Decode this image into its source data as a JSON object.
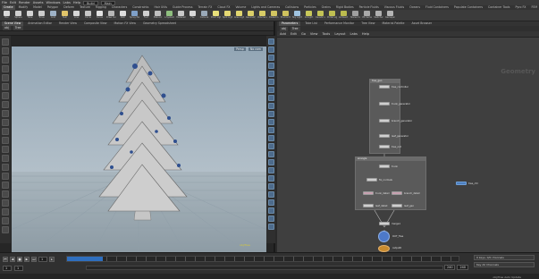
{
  "menubar": {
    "items": [
      "File",
      "Edit",
      "Render",
      "Assets",
      "Windows",
      "Labs",
      "Help"
    ],
    "build_select": "Build",
    "desktop_select": "Main"
  },
  "shelf_tabs": [
    "Create",
    "Modify",
    "Model",
    "Polygon",
    "Deform",
    "Texture",
    "Rigging",
    "Characters",
    "Constraints",
    "Hair Utils",
    "Guide Process",
    "Terrain FX",
    "Cloud FX",
    "Volume",
    "Lights and Cameras",
    "Collisions",
    "Particles",
    "Grains",
    "Rigid Bodies",
    "Particle Fluids",
    "Viscous Fluids",
    "Oceans",
    "Fluid Containers",
    "Populate Containers",
    "Container Tools",
    "Pyro FX",
    "FEM",
    "Wires",
    "Crowds",
    "Drive Simulation"
  ],
  "shelf_tools": [
    {
      "label": "Box",
      "color": "#d9d9d9"
    },
    {
      "label": "Sphere",
      "color": "#cfcfcf"
    },
    {
      "label": "Tube",
      "color": "#d4d4d4"
    },
    {
      "label": "Torus",
      "color": "#cccccc"
    },
    {
      "label": "Grid",
      "color": "#9fb3c8"
    },
    {
      "label": "Null",
      "color": "#e0c46a"
    },
    {
      "label": "Line",
      "color": "#d6d6d6"
    },
    {
      "label": "Circle",
      "color": "#c8c8c8"
    },
    {
      "label": "Curve",
      "color": "#e2e2e2"
    },
    {
      "label": "Draw Curve",
      "color": "#b8b8b8"
    },
    {
      "label": "Path",
      "color": "#dddddd"
    },
    {
      "label": "Spray Paint",
      "color": "#7fa0c8"
    },
    {
      "label": "Font",
      "color": "#d0d0d0"
    },
    {
      "label": "Platonic",
      "color": "#c0c0c0"
    },
    {
      "label": "L-System",
      "color": "#8fbf7f"
    },
    {
      "label": "Metaball",
      "color": "#c9c9c9"
    },
    {
      "label": "File",
      "color": "#d8d8d8"
    },
    {
      "label": "Camera",
      "color": "#9aa9b8"
    },
    {
      "label": "Point Light",
      "color": "#e8e07a"
    },
    {
      "label": "Spot Light",
      "color": "#e5d873"
    },
    {
      "label": "Area Light",
      "color": "#e1d66f"
    },
    {
      "label": "Geometry Light",
      "color": "#dcd069"
    },
    {
      "label": "Volume Light",
      "color": "#d8cc66"
    },
    {
      "label": "Distant Light",
      "color": "#d2c561"
    },
    {
      "label": "Environment Light",
      "color": "#cfc25e"
    },
    {
      "label": "Sky Light",
      "color": "#9fc3e0"
    },
    {
      "label": "GI Light",
      "color": "#c9c95a"
    },
    {
      "label": "Caustic Light",
      "color": "#c4c456"
    },
    {
      "label": "Portal Light",
      "color": "#bfbf52"
    },
    {
      "label": "Ambient Light",
      "color": "#bbbb4e"
    },
    {
      "label": "Stereo Camera",
      "color": "#a0a0a0"
    },
    {
      "label": "VR Camera",
      "color": "#a8a8a8"
    },
    {
      "label": "Switcher",
      "color": "#b0b0b0"
    },
    {
      "label": "Gamepad Camera",
      "color": "#b5b5b5"
    }
  ],
  "viewer": {
    "tabs": [
      "Scene View",
      "Animation Editor",
      "Render View",
      "Composite View",
      "Motion FX View",
      "Geometry Spreadsheet"
    ],
    "path": [
      "obj",
      "Tree"
    ],
    "cam_labels": [
      "Persp",
      "No cam"
    ],
    "footer": "obj/Tree"
  },
  "network": {
    "tabs": [
      "Tree View",
      "Material Palette",
      "Asset Browser"
    ],
    "pane_tabs": [
      "Parameters",
      "Take List",
      "Performance Monitor"
    ],
    "path": [
      "obj",
      "Tree"
    ],
    "menu": [
      "Add",
      "Edit",
      "Go",
      "View",
      "Tools",
      "Layout",
      "Labs",
      "Help"
    ],
    "context_title": "Geometry",
    "box1_title": "tree_gen",
    "box2_title": "wrangle",
    "nodes_box1": [
      "tree_controller",
      "trunk_generator",
      "branch_generator",
      "leaf_generator",
      "tree_out"
    ],
    "nodes_box2": [
      "trunk",
      "fix_normals",
      "trunk_detail",
      "branch_detail",
      "leaf_detail",
      "leaf_geo"
    ],
    "outside_node": "tree_ctrl",
    "nodes_chain": [
      "merge1",
      "OUT_Tree",
      "output0"
    ]
  },
  "timeline": {
    "start_frame": "1",
    "current_frame": "1",
    "end_frame": "240",
    "range_end": "240",
    "range_end2": "240",
    "keys_label": "0 keys, 0/0 channels",
    "key_all_label": "Key All Channels",
    "auto_update": "Auto Update",
    "status_text": "obj/Tree  Auto Update"
  },
  "chart_data": null
}
